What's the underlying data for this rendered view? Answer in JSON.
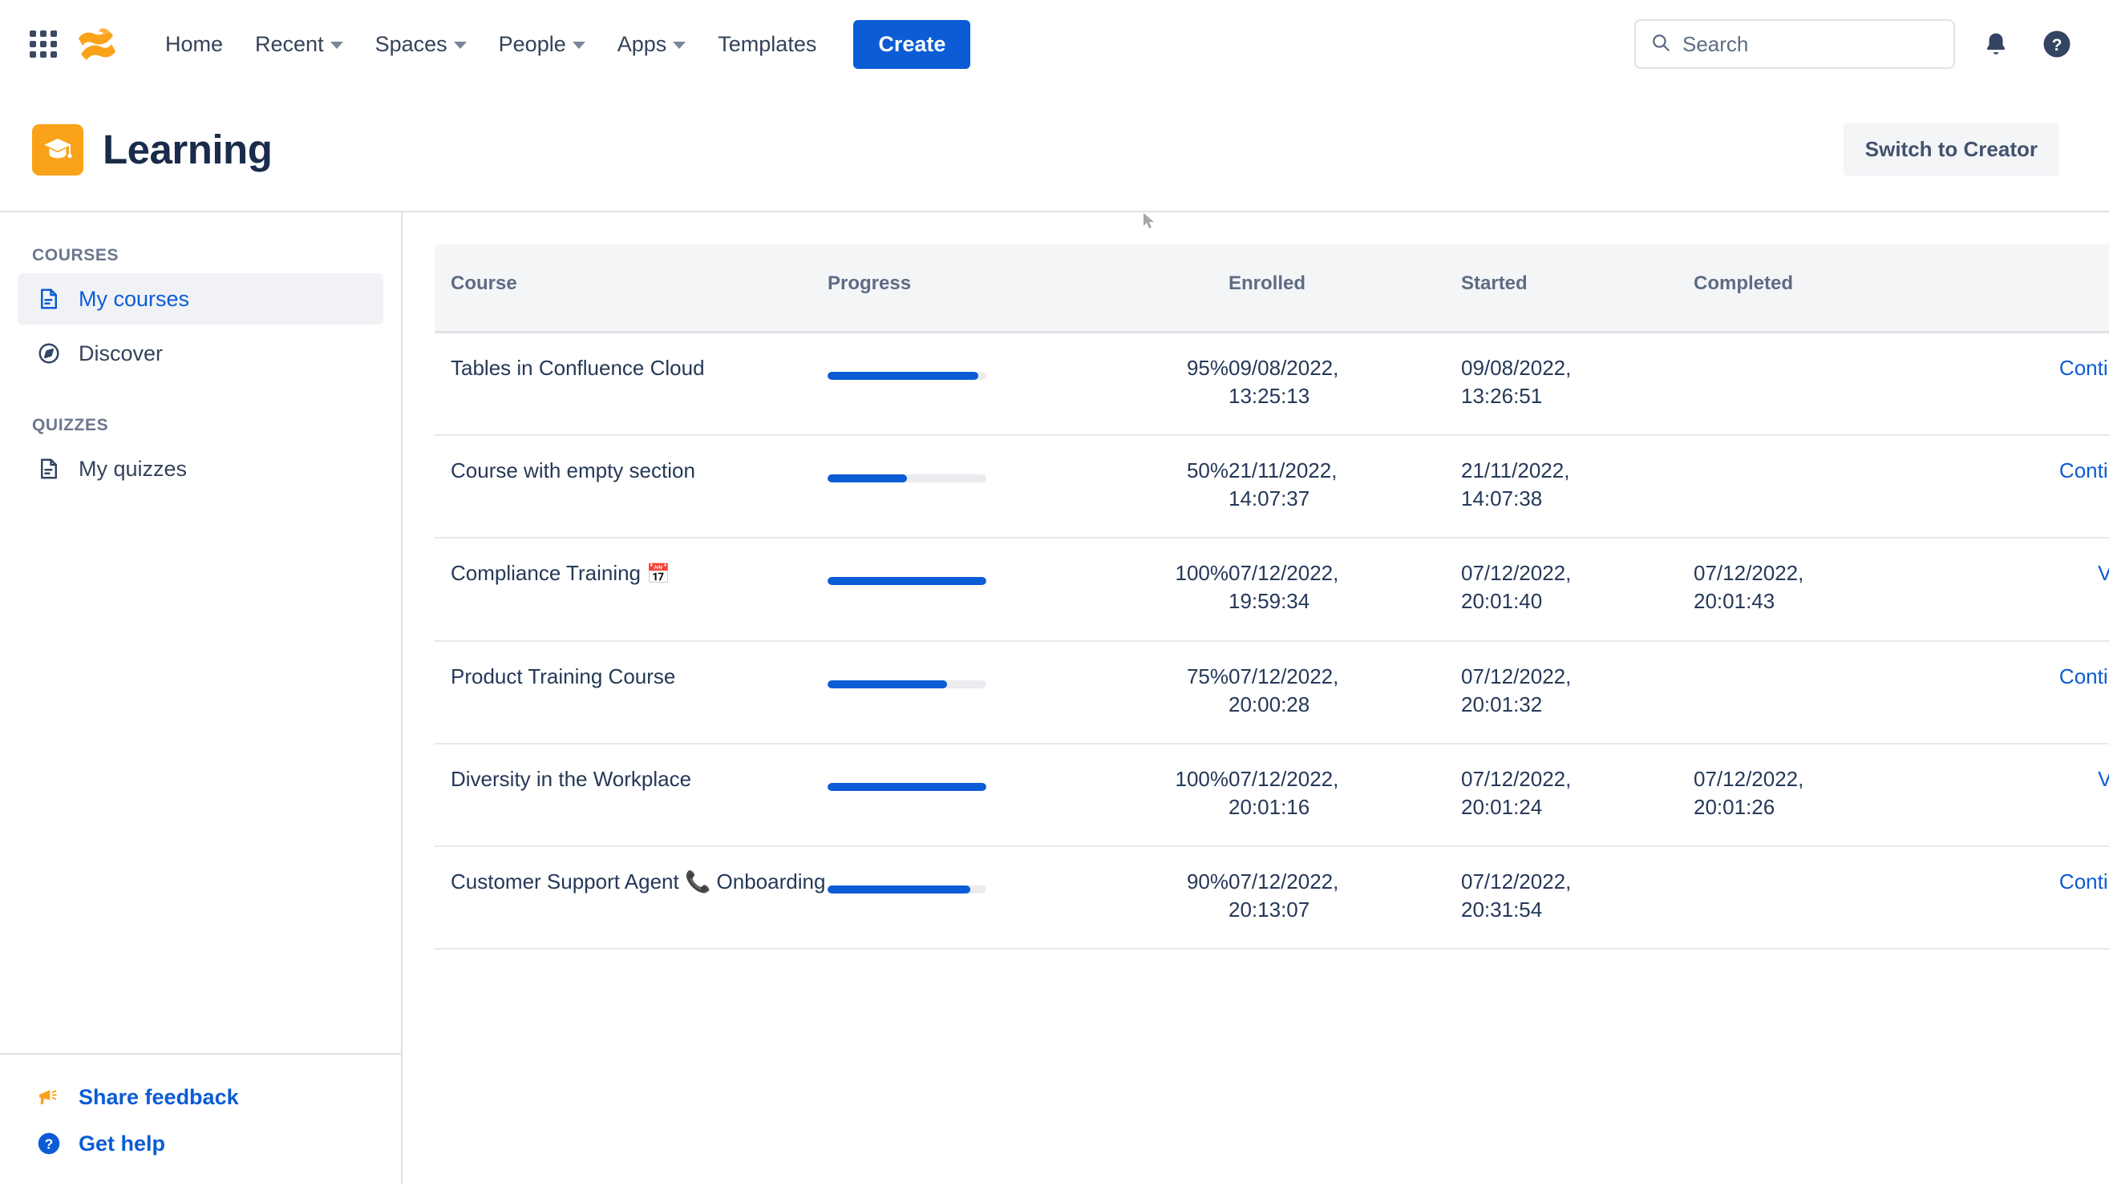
{
  "topnav": {
    "apps_icon": "apps-grid-icon",
    "brand_icon": "confluence-logo-icon",
    "items": [
      {
        "label": "Home",
        "has_caret": false
      },
      {
        "label": "Recent",
        "has_caret": true
      },
      {
        "label": "Spaces",
        "has_caret": true
      },
      {
        "label": "People",
        "has_caret": true
      },
      {
        "label": "Apps",
        "has_caret": true
      },
      {
        "label": "Templates",
        "has_caret": false
      }
    ],
    "create_label": "Create",
    "search_placeholder": "Search",
    "search_value": "",
    "notifications_icon": "bell-icon",
    "help_icon": "help-circle-icon"
  },
  "product_header": {
    "title": "Learning",
    "logo_icon": "graduation-cap-icon",
    "switch_label": "Switch to Creator"
  },
  "sidebar": {
    "sections": [
      {
        "label": "COURSES",
        "items": [
          {
            "label": "My courses",
            "icon": "document-icon",
            "active": true
          },
          {
            "label": "Discover",
            "icon": "compass-icon",
            "active": false
          }
        ]
      },
      {
        "label": "QUIZZES",
        "items": [
          {
            "label": "My quizzes",
            "icon": "document-icon",
            "active": false
          }
        ]
      }
    ],
    "footer": [
      {
        "label": "Share feedback",
        "icon": "megaphone-icon"
      },
      {
        "label": "Get help",
        "icon": "help-circle-icon"
      }
    ]
  },
  "table": {
    "columns": [
      "Course",
      "Progress",
      "Enrolled",
      "Started",
      "Completed"
    ],
    "rows": [
      {
        "course": "Tables in Confluence Cloud",
        "emoji": "",
        "progress": 95,
        "progress_label": "95%",
        "enrolled": "09/08/2022,\n13:25:13",
        "started": "09/08/2022,\n13:26:51",
        "completed": "",
        "action": "Continue"
      },
      {
        "course": "Course with empty section",
        "emoji": "",
        "progress": 50,
        "progress_label": "50%",
        "enrolled": "21/11/2022,\n14:07:37",
        "started": "21/11/2022,\n14:07:38",
        "completed": "",
        "action": "Continue"
      },
      {
        "course": "Compliance Training",
        "emoji": "📅",
        "progress": 100,
        "progress_label": "100%",
        "enrolled": "07/12/2022,\n19:59:34",
        "started": "07/12/2022,\n20:01:40",
        "completed": "07/12/2022,\n20:01:43",
        "action": "View"
      },
      {
        "course": "Product Training Course",
        "emoji": "",
        "progress": 75,
        "progress_label": "75%",
        "enrolled": "07/12/2022,\n20:00:28",
        "started": "07/12/2022,\n20:01:32",
        "completed": "",
        "action": "Continue"
      },
      {
        "course": "Diversity in the Workplace",
        "emoji": "",
        "progress": 100,
        "progress_label": "100%",
        "enrolled": "07/12/2022,\n20:01:16",
        "started": "07/12/2022,\n20:01:24",
        "completed": "07/12/2022,\n20:01:26",
        "action": "View"
      },
      {
        "course": "Customer Support Agent 📞 Onboarding",
        "emoji": "",
        "progress": 90,
        "progress_label": "90%",
        "enrolled": "07/12/2022,\n20:13:07",
        "started": "07/12/2022,\n20:31:54",
        "completed": "",
        "action": "Continue"
      }
    ]
  },
  "colors": {
    "accent_blue": "#0B5CD5",
    "brand_orange": "#FAA219",
    "text_dark": "#172B4D",
    "text_muted": "#5E6C84",
    "progress_track": "#EBECF0",
    "border": "#DFE1E6",
    "header_bg": "#F4F5F7"
  }
}
